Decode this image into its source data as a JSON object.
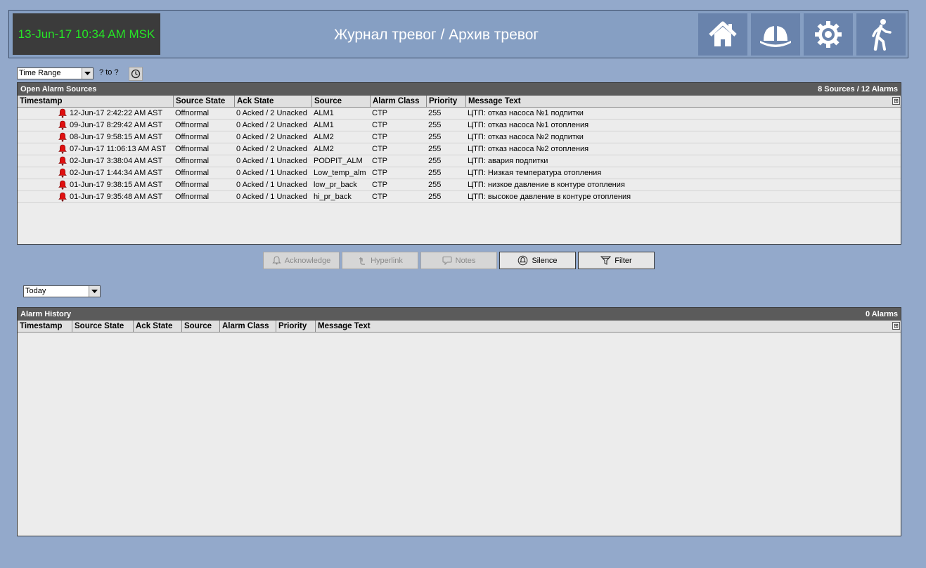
{
  "header": {
    "datetime": "13-Jun-17 10:34 AM MSK",
    "title": "Журнал тревог / Архив тревог",
    "nav": [
      {
        "icon": "home-icon"
      },
      {
        "icon": "helmet-icon"
      },
      {
        "icon": "gear-icon"
      },
      {
        "icon": "exit-icon"
      }
    ]
  },
  "time_range": {
    "selected": "Time Range",
    "from": "?",
    "to_label": "to",
    "to": "?"
  },
  "open_alarms": {
    "title": "Open Alarm Sources",
    "summary": "8 Sources / 12 Alarms",
    "columns": [
      "Timestamp",
      "Source State",
      "Ack State",
      "Source",
      "Alarm Class",
      "Priority",
      "Message Text"
    ],
    "rows": [
      {
        "timestamp": "12-Jun-17 2:42:22 AM AST",
        "source_state": "Offnormal",
        "ack_state": "0 Acked / 2 Unacked",
        "source": "ALM1",
        "alarm_class": "CTP",
        "priority": "255",
        "message": "ЦТП: отказ насоса №1 подпитки"
      },
      {
        "timestamp": "09-Jun-17 8:29:42 AM AST",
        "source_state": "Offnormal",
        "ack_state": "0 Acked / 2 Unacked",
        "source": "ALM1",
        "alarm_class": "CTP",
        "priority": "255",
        "message": "ЦТП: отказ насоса №1 отопления"
      },
      {
        "timestamp": "08-Jun-17 9:58:15 AM AST",
        "source_state": "Offnormal",
        "ack_state": "0 Acked / 2 Unacked",
        "source": "ALM2",
        "alarm_class": "CTP",
        "priority": "255",
        "message": "ЦТП: отказ насоса №2 подпитки"
      },
      {
        "timestamp": "07-Jun-17 11:06:13 AM AST",
        "source_state": "Offnormal",
        "ack_state": "0 Acked / 2 Unacked",
        "source": "ALM2",
        "alarm_class": "CTP",
        "priority": "255",
        "message": "ЦТП: отказ насоса №2 отопления"
      },
      {
        "timestamp": "02-Jun-17 3:38:04 AM AST",
        "source_state": "Offnormal",
        "ack_state": "0 Acked / 1 Unacked",
        "source": "PODPIT_ALM",
        "alarm_class": "CTP",
        "priority": "255",
        "message": "ЦТП: авария подпитки"
      },
      {
        "timestamp": "02-Jun-17 1:44:34 AM AST",
        "source_state": "Offnormal",
        "ack_state": "0 Acked / 1 Unacked",
        "source": "Low_temp_alm",
        "alarm_class": "CTP",
        "priority": "255",
        "message": "ЦТП: Низкая температура отопления"
      },
      {
        "timestamp": "01-Jun-17 9:38:15 AM AST",
        "source_state": "Offnormal",
        "ack_state": "0 Acked / 1 Unacked",
        "source": "low_pr_back",
        "alarm_class": "CTP",
        "priority": "255",
        "message": "ЦТП: низкое давление в контуре отопления"
      },
      {
        "timestamp": "01-Jun-17 9:35:48 AM AST",
        "source_state": "Offnormal",
        "ack_state": "0 Acked / 1 Unacked",
        "source": "hi_pr_back",
        "alarm_class": "CTP",
        "priority": "255",
        "message": "ЦТП: высокое давление в контуре отопления"
      }
    ]
  },
  "actions": {
    "acknowledge": "Acknowledge",
    "hyperlink": "Hyperlink",
    "notes": "Notes",
    "silence": "Silence",
    "filter": "Filter"
  },
  "history_range": {
    "selected": "Today"
  },
  "alarm_history": {
    "title": "Alarm History",
    "summary": "0 Alarms",
    "columns": [
      "Timestamp",
      "Source State",
      "Ack State",
      "Source",
      "Alarm Class",
      "Priority",
      "Message Text"
    ]
  },
  "colors": {
    "background": "#93a9cb",
    "header": "#869fc3",
    "nav_button": "#6983ac",
    "clock_text": "#26e626",
    "bell": "#e01010"
  }
}
